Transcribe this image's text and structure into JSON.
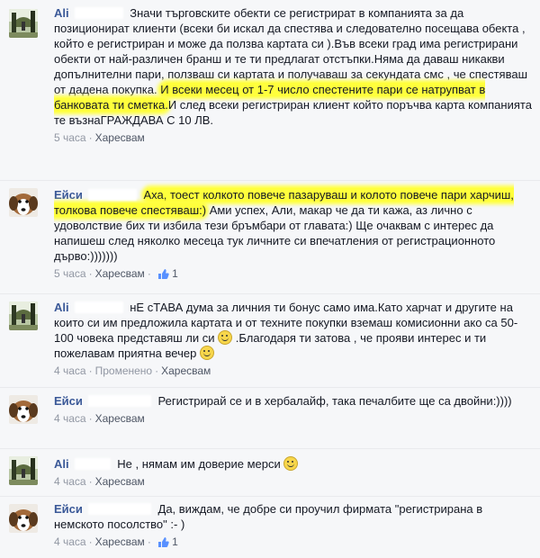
{
  "comments": [
    {
      "author": "Ali",
      "text": "Значи търговските обекти се регистрират в компанията за да позиционират клиенти (всеки би искал да спестява и следователно посещава обекта , който е регистриран и може да ползва картата си ).Във всеки град има регистрирани обекти от най-различен бранш и те ти предлагат отстъпки.Няма да даваш никакви допълнителни пари, ползваш си картата и получаваш за секундата смс , че спестяваш от дадена покупка.",
      "text_highlight": "И всеки месец от 1-7 число спестените пари се натрупват в банковата ти сметка.",
      "text_after": "И след всеки регистриран клиент който поръчва карта компанията те възнаГРАЖДАВА С 10 ЛВ.",
      "time": "5 часа",
      "like": "Харесвам"
    },
    {
      "author": "Ейси",
      "text_highlight": "Аха, тоест колкото повече пазаруваш и колото повече пари харчиш, толкова повече спестяваш:)",
      "text_after": " Ами успех, Али, макар че да ти кажа, аз лично с удоволствие бих ти избила тези бръмбари от главата:) Ще очаквам с интерес да напишеш след няколко месеца тук личните си впечатления от регистрационното дърво:)))))))",
      "time": "5 часа",
      "like": "Харесвам",
      "like_count": "1"
    },
    {
      "author": "Ali",
      "text": "нЕ сТАВА дума за личния ти бонус само има.Като харчат и другите на които си им предложила картата и от техните покупки вземаш комисионни ако са 50-100 човека представяш ли си",
      "text_mid": " .Благодаря ти затова , че прояви интерес и ти пожелавам приятна вечер",
      "time": "4 часа",
      "edited": "Променено",
      "like": "Харесвам"
    },
    {
      "author": "Ейси",
      "text": "Регистрирай се и в хербалайф, така печалбите ще са двойни:))))",
      "time": "4 часа",
      "like": "Харесвам"
    },
    {
      "author": "Ali",
      "text": "Не , нямам им доверие мерси",
      "time": "4 часа",
      "like": "Харесвам"
    },
    {
      "author": "Ейси",
      "text": "Да, виждам, че добре си проучил фирмата \"регистрирана в немското посолство\" :- )",
      "time": "4 часа",
      "like": "Харесвам",
      "like_count": "1"
    }
  ],
  "separator": "·",
  "colors": {
    "link": "#3b5998",
    "highlight": "#ffff3c",
    "meta": "#9197a3"
  }
}
